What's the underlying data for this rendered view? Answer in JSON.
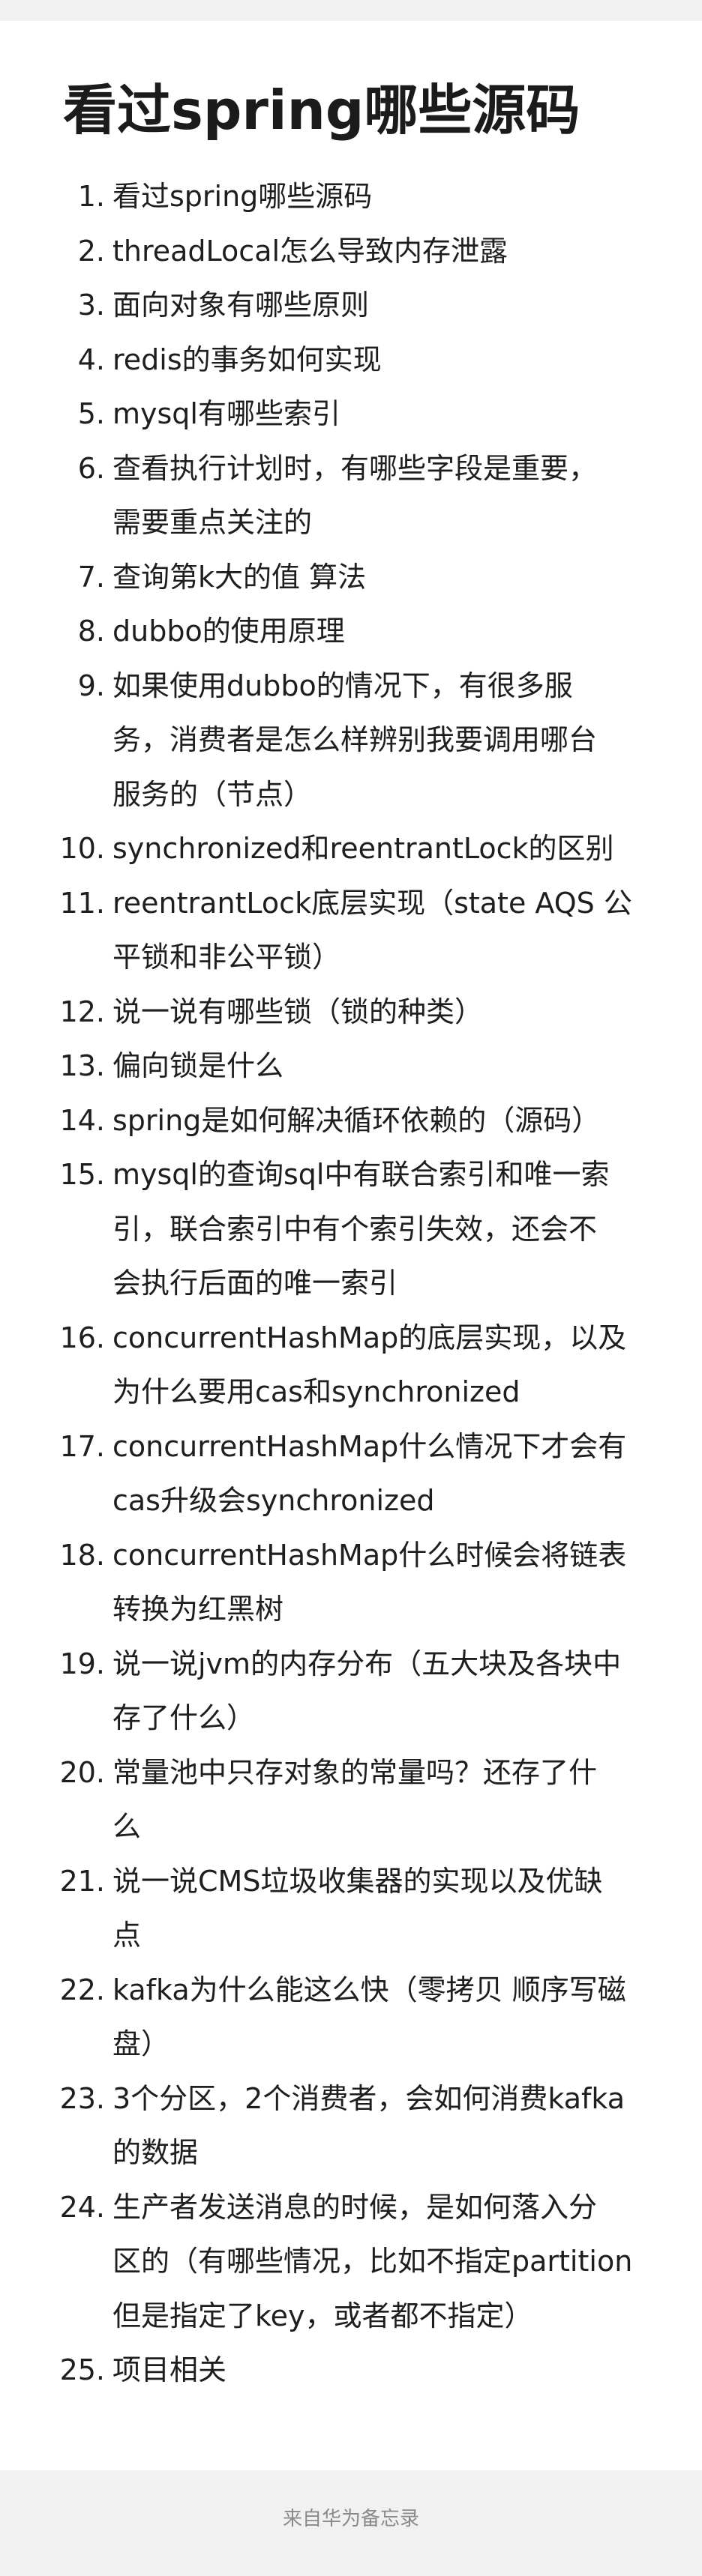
{
  "note": {
    "title": "看过spring哪些源码",
    "items": [
      {
        "number": "1.",
        "lines": [
          " 看过spring哪些源码"
        ]
      },
      {
        "number": "2.",
        "lines": [
          "threadLocal怎么导致内存泄露"
        ]
      },
      {
        "number": "3.",
        "lines": [
          "面向对象有哪些原则"
        ]
      },
      {
        "number": "4.",
        "lines": [
          "redis的事务如何实现"
        ]
      },
      {
        "number": "5.",
        "lines": [
          "mysql有哪些索引"
        ]
      },
      {
        "number": "6.",
        "lines": [
          "查看执行计划时，有哪些字段是重要，",
          "需要重点关注的"
        ]
      },
      {
        "number": "7.",
        "lines": [
          "查询第k大的值 算法"
        ]
      },
      {
        "number": "8.",
        "lines": [
          "dubbo的使用原理"
        ]
      },
      {
        "number": "9.",
        "lines": [
          "如果使用dubbo的情况下，有很多服",
          "务，消费者是怎么样辨别我要调用哪台",
          "服务的（节点）"
        ]
      },
      {
        "number": "10.",
        "lines": [
          "synchronized和reentrantLock的区别"
        ]
      },
      {
        "number": "11.",
        "lines": [
          "reentrantLock底层实现（state AQS 公",
          "平锁和非公平锁）"
        ]
      },
      {
        "number": "12.",
        "lines": [
          "说一说有哪些锁（锁的种类）"
        ]
      },
      {
        "number": "13.",
        "lines": [
          "偏向锁是什么"
        ]
      },
      {
        "number": "14.",
        "lines": [
          "spring是如何解决循环依赖的（源码）"
        ]
      },
      {
        "number": "15.",
        "lines": [
          "mysql的查询sql中有联合索引和唯一索",
          "引，联合索引中有个索引失效，还会不",
          "会执行后面的唯一索引"
        ]
      },
      {
        "number": "16.",
        "lines": [
          "concurrentHashMap的底层实现，以及",
          "为什么要用cas和synchronized"
        ]
      },
      {
        "number": "17.",
        "lines": [
          "concurrentHashMap什么情况下才会有",
          "cas升级会synchronized"
        ]
      },
      {
        "number": "18.",
        "lines": [
          "concurrentHashMap什么时候会将链表",
          "转换为红黑树"
        ]
      },
      {
        "number": "19.",
        "lines": [
          "说一说jvm的内存分布（五大块及各块中",
          "存了什么）"
        ]
      },
      {
        "number": "20.",
        "lines": [
          "常量池中只存对象的常量吗？还存了什",
          "么"
        ]
      },
      {
        "number": "21.",
        "lines": [
          "说一说CMS垃圾收集器的实现以及优缺",
          "点"
        ]
      },
      {
        "number": "22.",
        "lines": [
          "kafka为什么能这么快（零拷贝 顺序写磁",
          "盘）"
        ]
      },
      {
        "number": "23.",
        "lines": [
          "3个分区，2个消费者，会如何消费kafka",
          "的数据"
        ]
      },
      {
        "number": "24.",
        "lines": [
          "生产者发送消息的时候，是如何落入分",
          "区的（有哪些情况，比如不指定partition",
          "但是指定了key，或者都不指定）"
        ]
      },
      {
        "number": "25.",
        "lines": [
          "项目相关"
        ]
      }
    ]
  },
  "footer": {
    "source_label": "来自华为备忘录"
  },
  "colors": {
    "page_background": "#ffffff",
    "outer_background": "#f1f1f1",
    "text": "#1e1e1e",
    "footer_text": "#8a8a8a"
  }
}
